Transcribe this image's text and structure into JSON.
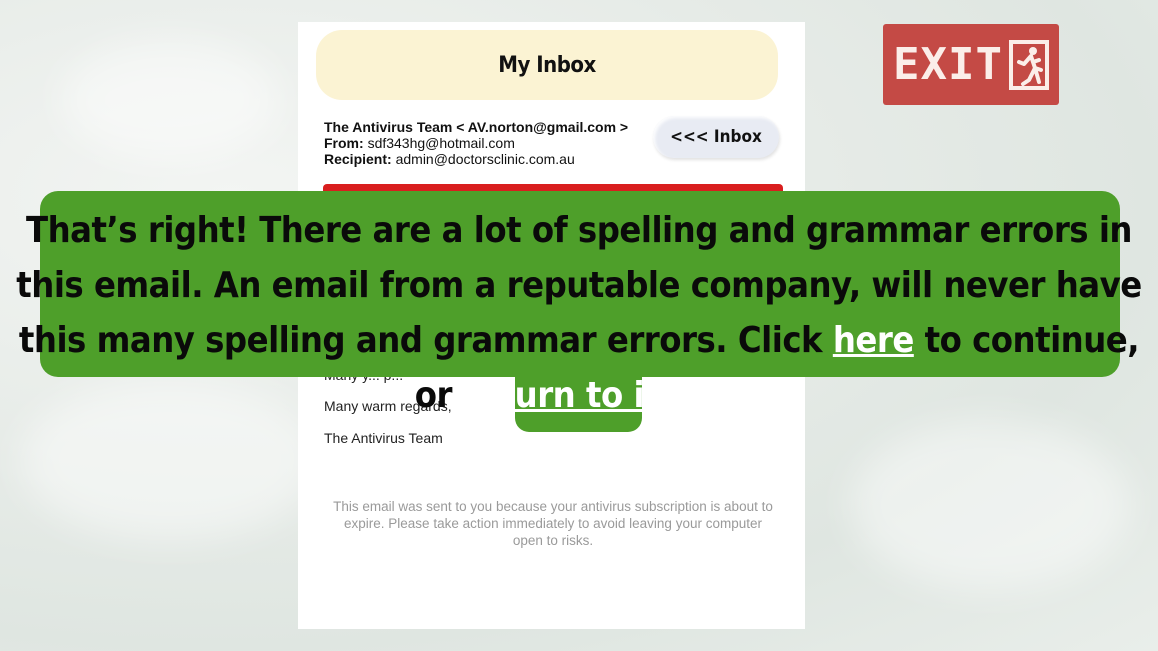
{
  "inbox": {
    "title": "My Inbox",
    "back_button": "<<< Inbox"
  },
  "email": {
    "sender_line": "The Antivirus Team < AV.norton@gmail.com >",
    "from_label": "From:",
    "from_value": "sdf343hg@hotmail.com",
    "recipient_label": "Recipient:",
    "recipient_value": "admin@doctorsclinic.com.au",
    "partial_line": "Many y... p...",
    "signoff": "Many warm regards,",
    "signature": "The Antivirus Team",
    "footer": "This email was sent to you because your antivirus subscription is about to expire. Please take action immediately to avoid leaving your computer open to risks."
  },
  "exit": {
    "label": "EXIT",
    "icon": "running-man-exit-icon"
  },
  "feedback": {
    "text_before": "That’s right! There are a lot of spelling and grammar errors in this email. An email from a reputable company, will never have this many spelling and grammar errors. Click ",
    "here_link": "here",
    "text_middle": " to continue, or ",
    "return_link": "return to inbox."
  },
  "colors": {
    "feedback_green": "#4e9f2a",
    "exit_red": "#c44a45",
    "header_cream": "#fbf3d3",
    "banner_red": "#d91e1e"
  }
}
